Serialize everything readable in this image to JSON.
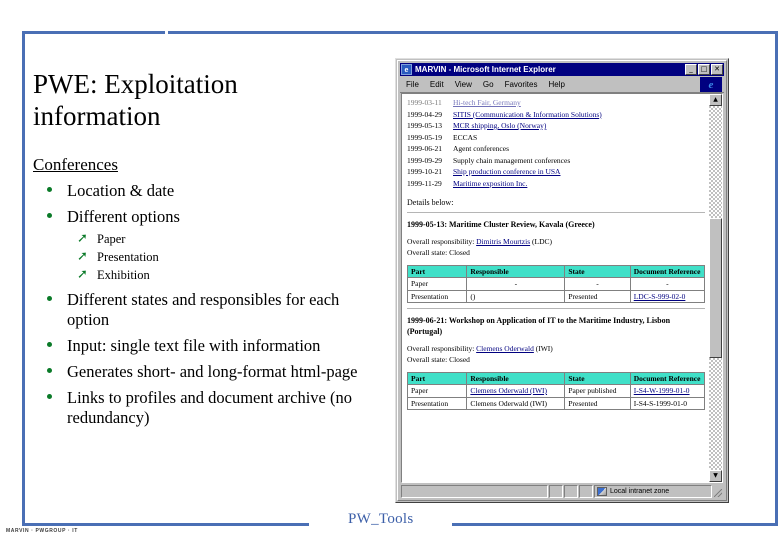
{
  "slide": {
    "title": "PWE: Exploitation information",
    "section_heading": "Conferences",
    "bullets": [
      {
        "text": "Location & date",
        "sub": []
      },
      {
        "text": "Different options",
        "sub": [
          "Paper",
          "Presentation",
          "Exhibition"
        ]
      },
      {
        "text": "Different states and responsibles for each option",
        "sub": []
      },
      {
        "text": "Input: single text file with information",
        "sub": []
      },
      {
        "text": "Generates short- and long-format html-page",
        "sub": []
      },
      {
        "text": "Links to profiles and document archive (no redundancy)",
        "sub": []
      }
    ],
    "footer_label": "PW_Tools",
    "footer_tiny": "MARVIN · PWGROUP · IT",
    "accent_color": "#4a6fb5",
    "bullet_color": "#0a7a28",
    "footer_color": "#3c5fa8"
  },
  "browser": {
    "title": "MARVIN - Microsoft Internet Explorer",
    "app_icon": "ie-document-icon",
    "window_buttons": [
      {
        "name": "minimize",
        "glyph": "_"
      },
      {
        "name": "maximize",
        "glyph": "□"
      },
      {
        "name": "close",
        "glyph": "✕"
      }
    ],
    "menu": [
      "File",
      "Edit",
      "View",
      "Go",
      "Favorites",
      "Help"
    ],
    "ie_logo_letter": "e",
    "scrollbar": {
      "up_glyph": "▲",
      "down_glyph": "▼"
    },
    "page": {
      "link_rows": [
        {
          "date": "1999-03-11",
          "text": "Hi-tech Fair, Germany",
          "link": true,
          "faded": true
        },
        {
          "date": "1999-04-29",
          "text": "SITIS (Communication & Information Solutions)",
          "link": true,
          "faded": false
        },
        {
          "date": "1999-05-13",
          "text": "MCR shipping, Oslo (Norway)",
          "link": true,
          "faded": false
        },
        {
          "date": "1999-05-19",
          "text": "ECCAS",
          "link": false,
          "faded": false
        },
        {
          "date": "1999-06-21",
          "text": "Agent conferences",
          "link": false,
          "faded": false
        },
        {
          "date": "1999-09-29",
          "text": "Supply chain management conferences",
          "link": false,
          "faded": false
        },
        {
          "date": "1999-10-21",
          "text": "Ship production conference in USA",
          "link": true,
          "faded": false
        },
        {
          "date": "1999-11-29",
          "text": "Maritime exposition Inc.",
          "link": true,
          "faded": false
        }
      ],
      "details_label": "Details below:",
      "events": [
        {
          "title": "1999-05-13: Maritime Cluster Review, Kavala (Greece)",
          "responsibility_label": "Overall responsibility:",
          "responsibility_person": "Dimitris Mourtzis",
          "responsibility_org": "(LDC)",
          "state_label": "Overall state:",
          "state_value": "Closed",
          "table": {
            "headers": [
              "Part",
              "Responsible",
              "State",
              "Document Reference"
            ],
            "rows": [
              [
                "Paper",
                "-",
                "-",
                "-"
              ],
              [
                "Presentation",
                "()",
                "Presented",
                "LDC-S-999-02-0"
              ]
            ],
            "link_cells": [
              [
                3
              ]
            ]
          }
        },
        {
          "title": "1999-06-21: Workshop on Application of IT to the Maritime Industry, Lisbon (Portugal)",
          "responsibility_label": "Overall responsibility:",
          "responsibility_person": "Clemens Oderwald",
          "responsibility_org": "(IWI)",
          "state_label": "Overall state:",
          "state_value": "Closed",
          "table": {
            "headers": [
              "Part",
              "Responsible",
              "State",
              "Document Reference"
            ],
            "rows": [
              [
                "Paper",
                "Clemens Oderwald (IWI)",
                "Paper published",
                "I-S4-W-1999-01-0"
              ],
              [
                "Presentation",
                "Clemens Oderwald (IWI)",
                "Presented",
                "I-S4-S-1999-01-0"
              ]
            ]
          }
        }
      ]
    },
    "status": {
      "zone_text": "Local intranet zone",
      "zone_icon": "intranet-zone-icon"
    },
    "table_header_color": "#40e0c8",
    "titlebar_color": "#000080"
  }
}
